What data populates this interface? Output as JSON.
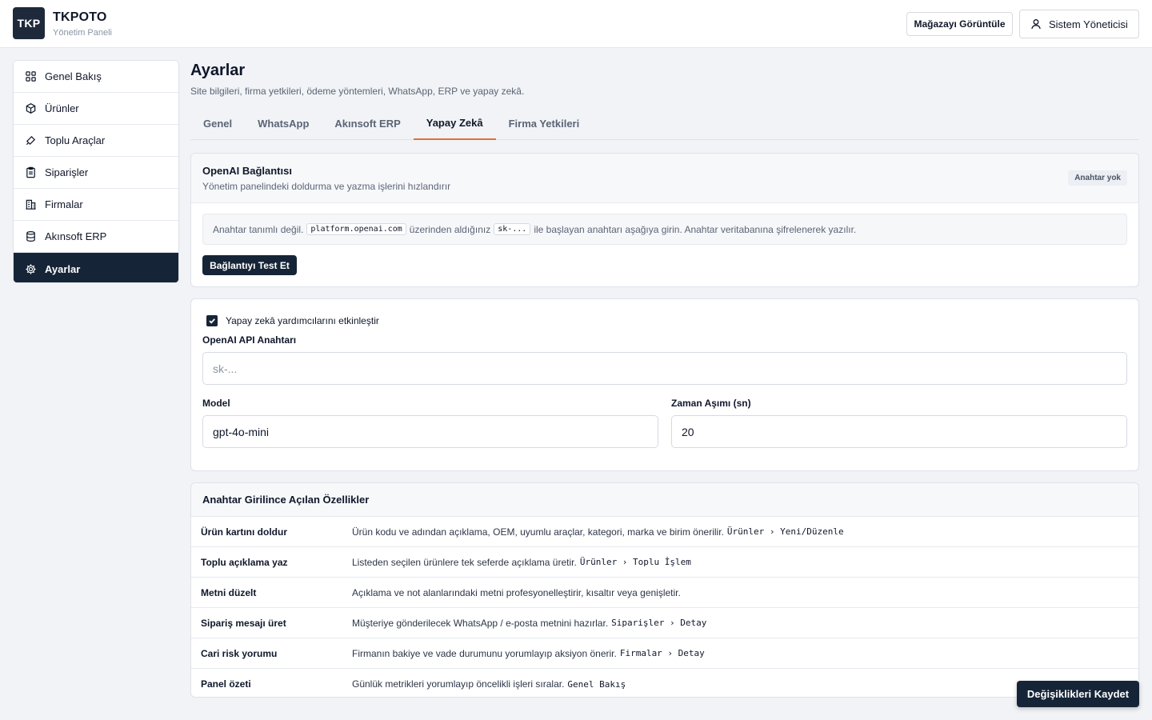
{
  "header": {
    "logo": "TKP",
    "brand": "TKPOTO",
    "subtitle": "Yönetim Paneli",
    "view_store": "Mağazayı Görüntüle",
    "user": "Sistem Yöneticisi",
    "user_icon": "user-icon"
  },
  "sidebar": {
    "items": [
      {
        "label": "Genel Bakış",
        "icon": "grid-icon"
      },
      {
        "label": "Ürünler",
        "icon": "box-icon"
      },
      {
        "label": "Toplu Araçlar",
        "icon": "tag-icon"
      },
      {
        "label": "Siparişler",
        "icon": "clipboard-icon"
      },
      {
        "label": "Firmalar",
        "icon": "building-icon"
      },
      {
        "label": "Akınsoft ERP",
        "icon": "database-icon"
      },
      {
        "label": "Ayarlar",
        "icon": "gear-icon",
        "active": true
      }
    ]
  },
  "page": {
    "title": "Ayarlar",
    "subtitle": "Site bilgileri, firma yetkileri, ödeme yöntemleri, WhatsApp, ERP ve yapay zekâ."
  },
  "tabs": [
    {
      "label": "Genel"
    },
    {
      "label": "WhatsApp"
    },
    {
      "label": "Akınsoft ERP"
    },
    {
      "label": "Yapay Zekâ",
      "active": true
    },
    {
      "label": "Firma Yetkileri"
    }
  ],
  "openai": {
    "title": "OpenAI Bağlantısı",
    "desc": "Yönetim panelindeki doldurma ve yazma işlerini hızlandırır",
    "badge": "Anahtar yok",
    "notice_pre": "Anahtar tanımlı değil.",
    "notice_code1": "platform.openai.com",
    "notice_mid": "üzerinden aldığınız",
    "notice_code2": "sk-...",
    "notice_post": "ile başlayan anahtarı aşağıya girin. Anahtar veritabanına şifrelenerek yazılır.",
    "test_button": "Bağlantıyı Test Et"
  },
  "ai_settings": {
    "enable_label": "Yapay zekâ yardımcılarını etkinleştir",
    "enabled": true,
    "api_key_label": "OpenAI API Anahtarı",
    "api_key_placeholder": "sk-...",
    "api_key_value": "",
    "model_label": "Model",
    "model_value": "gpt-4o-mini",
    "timeout_label": "Zaman Aşımı (sn)",
    "timeout_value": "20"
  },
  "features": {
    "title": "Anahtar Girilince Açılan Özellikler",
    "rows": [
      {
        "name": "Ürün kartını doldur",
        "desc": "Ürün kodu ve adından açıklama, OEM, uyumlu araçlar, kategori, marka ve birim önerilir.",
        "path": "Ürünler › Yeni/Düzenle"
      },
      {
        "name": "Toplu açıklama yaz",
        "desc": "Listeden seçilen ürünlere tek seferde açıklama üretir.",
        "path": "Ürünler › Toplu İşlem"
      },
      {
        "name": "Metni düzelt",
        "desc": "Açıklama ve not alanlarındaki metni profesyonelleştirir, kısaltır veya genişletir.",
        "path": ""
      },
      {
        "name": "Sipariş mesajı üret",
        "desc": "Müşteriye gönderilecek WhatsApp / e-posta metnini hazırlar.",
        "path": "Siparişler › Detay"
      },
      {
        "name": "Cari risk yorumu",
        "desc": "Firmanın bakiye ve vade durumunu yorumlayıp aksiyon önerir.",
        "path": "Firmalar › Detay"
      },
      {
        "name": "Panel özeti",
        "desc": "Günlük metrikleri yorumlayıp öncelikli işleri sıralar.",
        "path": "Genel Bakış"
      }
    ]
  },
  "save_button": "Değişiklikleri Kaydet",
  "colors": {
    "primary": "#162437",
    "accent": "#e0703a",
    "background": "#f1f3f6"
  }
}
